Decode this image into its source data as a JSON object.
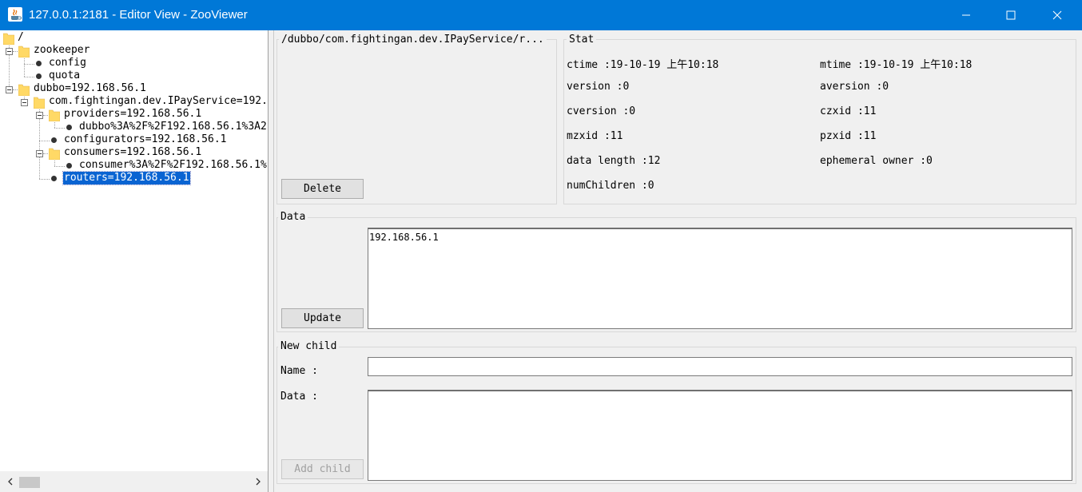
{
  "window": {
    "title": "127.0.0.1:2181 - Editor View - ZooViewer"
  },
  "tree": {
    "nodes": [
      {
        "label": "/"
      },
      {
        "label": "zookeeper"
      },
      {
        "label": "config"
      },
      {
        "label": "quota"
      },
      {
        "label": "dubbo=192.168.56.1"
      },
      {
        "label": "com.fightingan.dev.IPayService=192."
      },
      {
        "label": "providers=192.168.56.1"
      },
      {
        "label": "dubbo%3A%2F%2F192.168.56.1%3A2"
      },
      {
        "label": "configurators=192.168.56.1"
      },
      {
        "label": "consumers=192.168.56.1"
      },
      {
        "label": "consumer%3A%2F%2F192.168.56.1%"
      },
      {
        "label": "routers=192.168.56.1"
      }
    ]
  },
  "node_panel": {
    "path": "/dubbo/com.fightingan.dev.IPayService/r...",
    "delete_label": "Delete"
  },
  "stat": {
    "title": "Stat",
    "ctime": "ctime :19-10-19 上午10:18",
    "mtime": "mtime :19-10-19 上午10:18",
    "version": "version :0",
    "aversion": "aversion :0",
    "cversion": "cversion :0",
    "czxid": "czxid :11",
    "mzxid": "mzxid :11",
    "pzxid": "pzxid :11",
    "data_length": "data length :12",
    "ephemeral_owner": "ephemeral owner :0",
    "num_children": "numChildren :0"
  },
  "data_panel": {
    "title": "Data",
    "value": "192.168.56.1",
    "update_label": "Update"
  },
  "new_child": {
    "title": "New child",
    "name_label": "Name :",
    "name_value": "",
    "data_label": "Data :",
    "data_value": "",
    "add_label": "Add child"
  },
  "colors": {
    "titlebar": "#0078d7",
    "selection": "#0a64d2",
    "folder": "#ffd966"
  }
}
